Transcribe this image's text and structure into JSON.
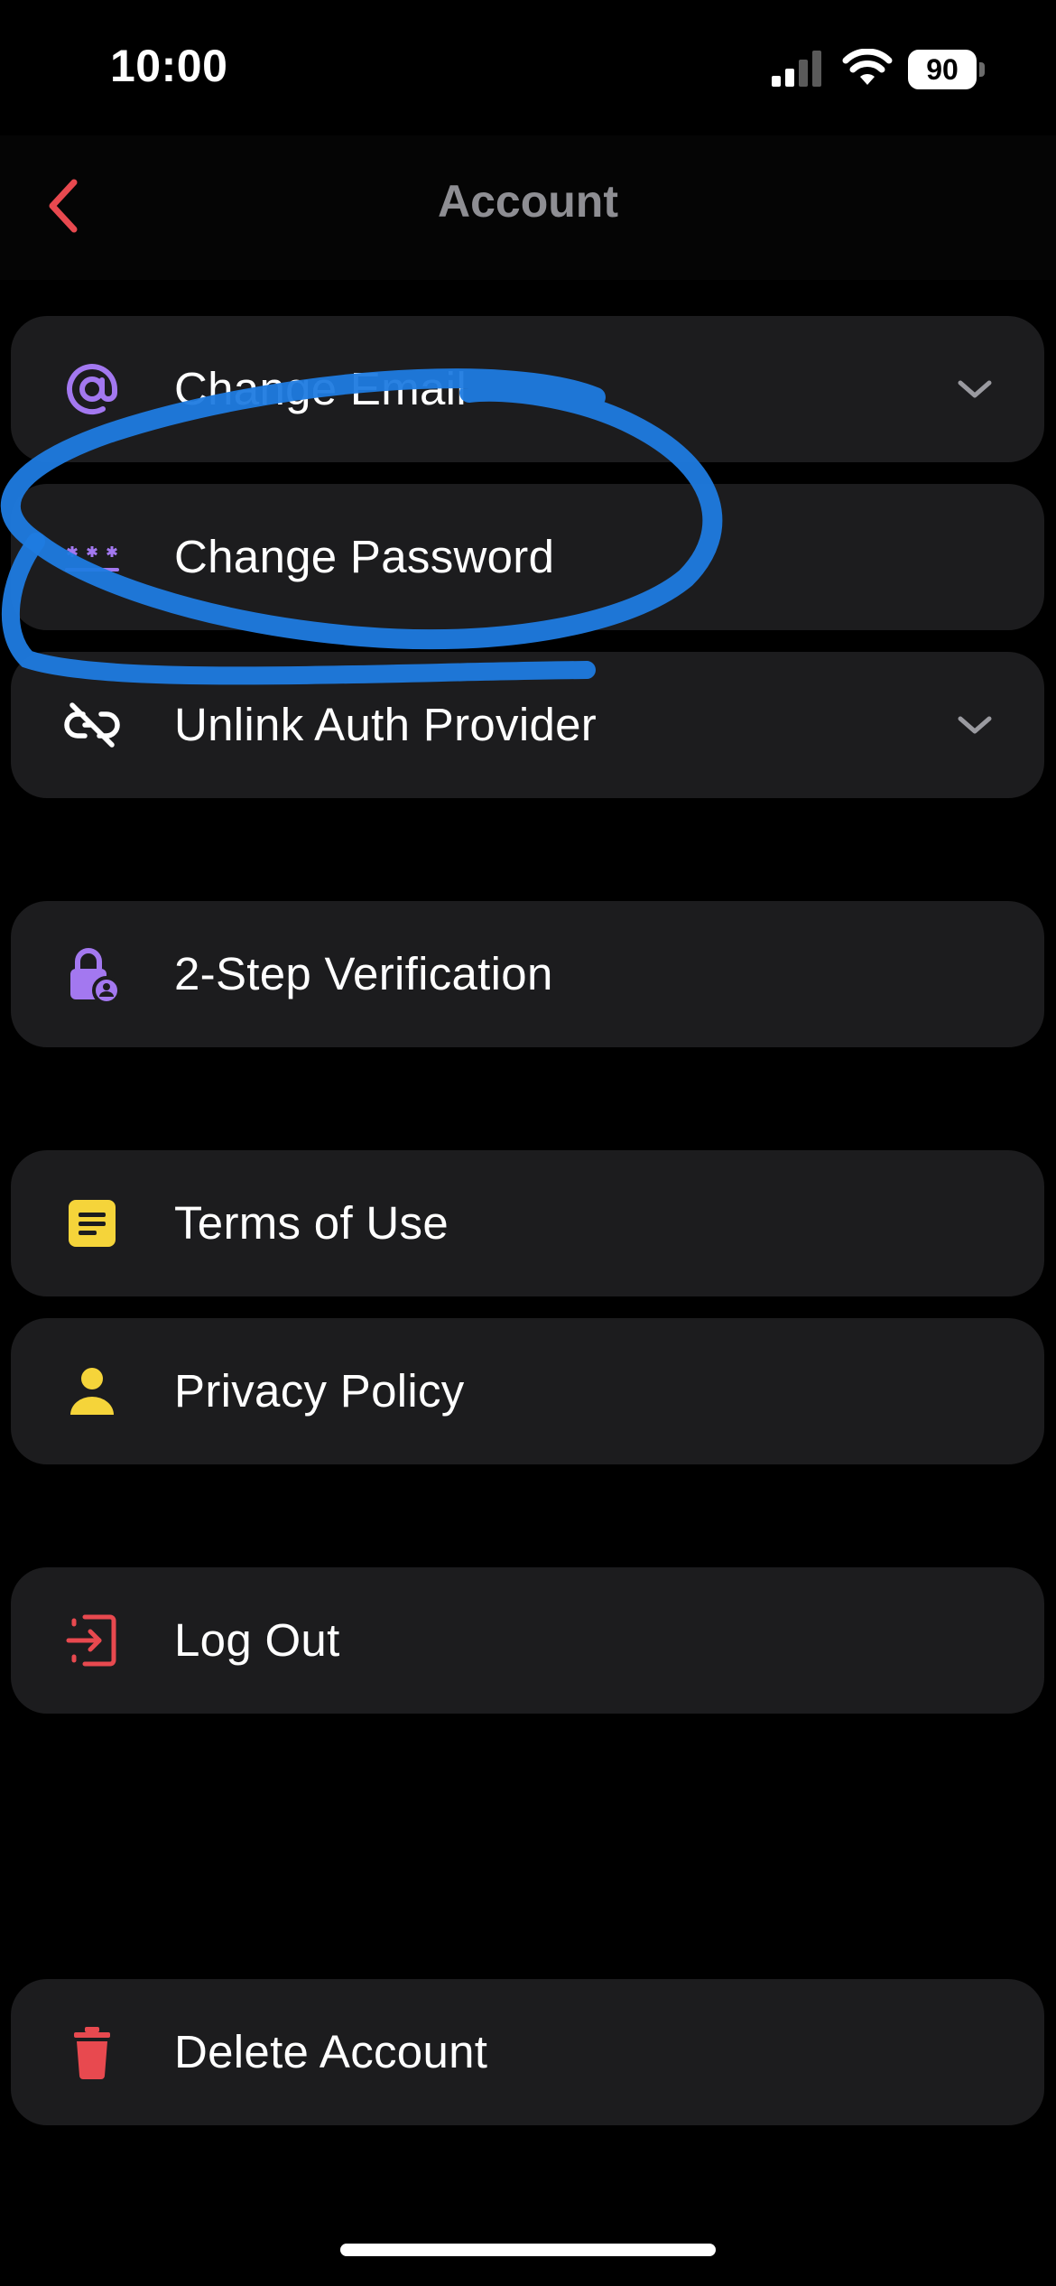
{
  "status_bar": {
    "time": "10:00",
    "battery": "90",
    "icons": [
      "cellular-signal-icon",
      "wifi-icon",
      "battery-icon"
    ]
  },
  "nav": {
    "title": "Account",
    "back_icon": "chevron-left-icon"
  },
  "colors": {
    "background": "#000000",
    "row_background": "#1c1c1e",
    "accent_red": "#e8494f",
    "purple": "#a378f0",
    "yellow": "#f5d43a",
    "title_gray": "#8e8e93",
    "annotation_blue": "#1f7be0"
  },
  "rows": {
    "change_email": {
      "label": "Change Email",
      "icon": "at-sign-icon",
      "expandable": true
    },
    "change_password": {
      "label": "Change Password",
      "icon": "password-icon",
      "expandable": false
    },
    "unlink_auth": {
      "label": "Unlink Auth Provider",
      "icon": "unlink-icon",
      "expandable": true
    },
    "two_step": {
      "label": "2-Step Verification",
      "icon": "lock-user-icon",
      "expandable": false
    },
    "terms": {
      "label": "Terms of Use",
      "icon": "document-icon",
      "expandable": false
    },
    "privacy": {
      "label": "Privacy Policy",
      "icon": "person-icon",
      "expandable": false
    },
    "logout": {
      "label": "Log Out",
      "icon": "logout-icon",
      "expandable": false
    },
    "delete": {
      "label": "Delete Account",
      "icon": "trash-icon",
      "expandable": false
    }
  }
}
